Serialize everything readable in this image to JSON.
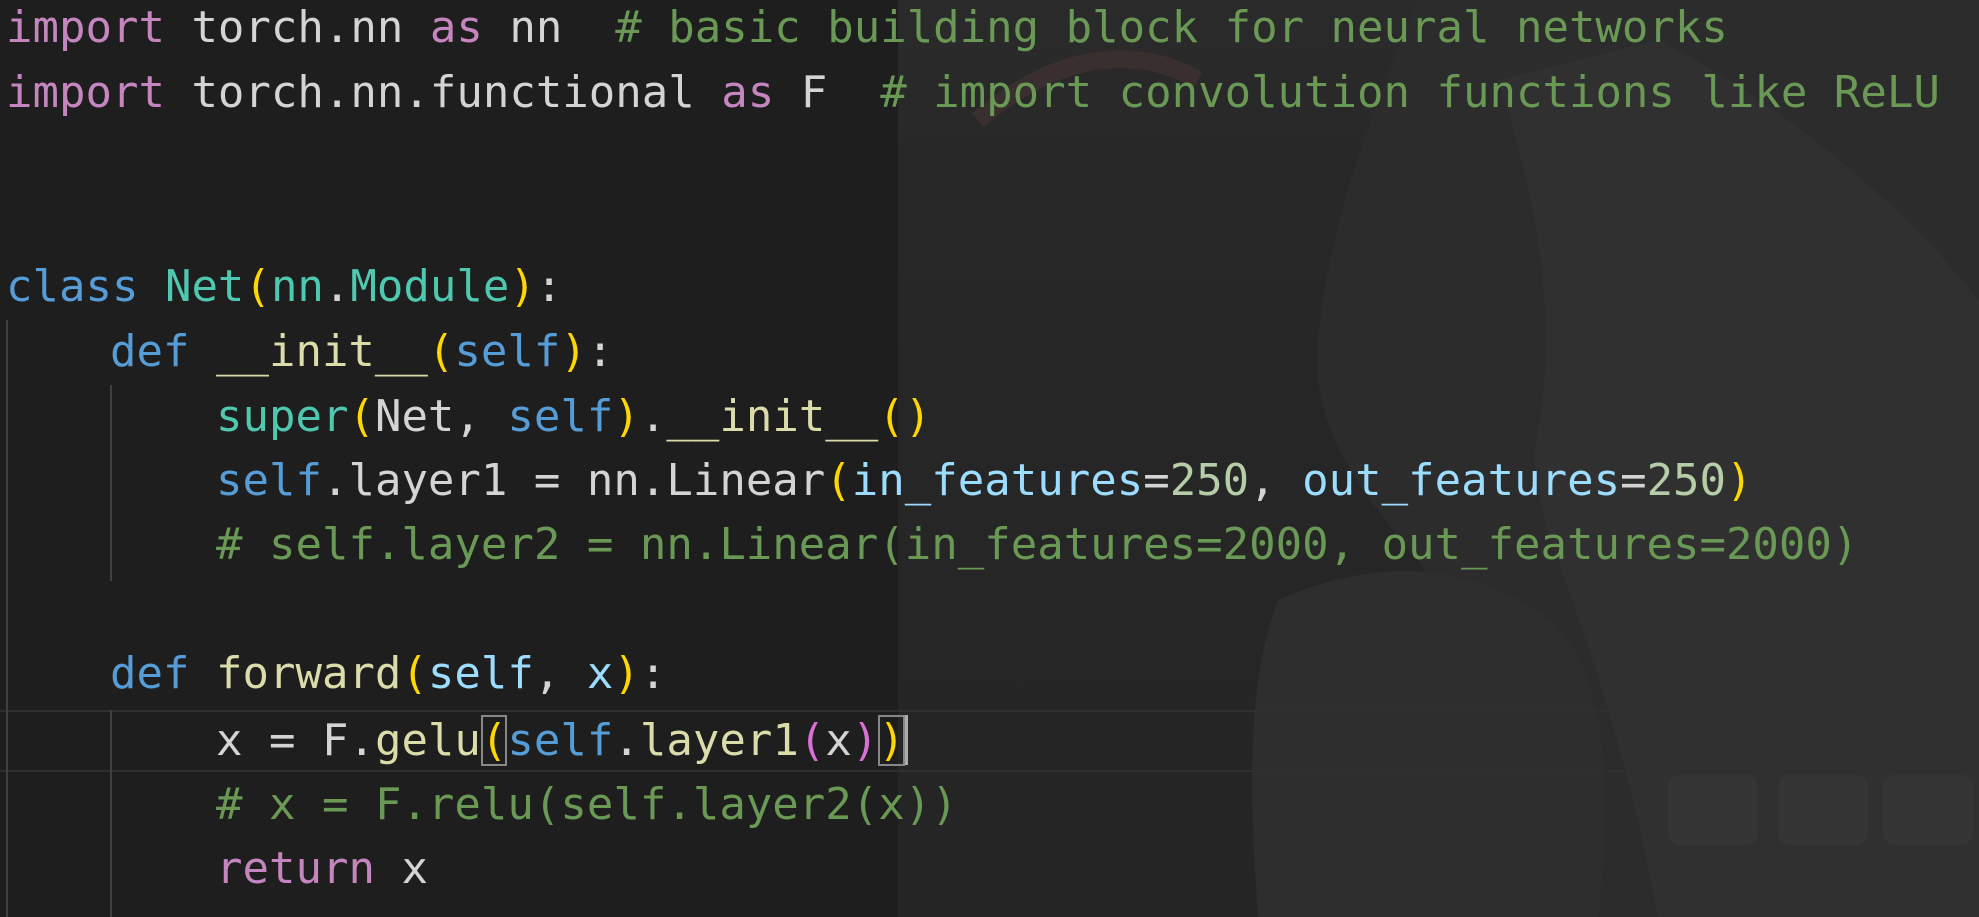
{
  "editor": {
    "lines": {
      "l1": {
        "import_kw": "import",
        "module": " torch.nn ",
        "as_kw": "as",
        "alias": " nn  ",
        "comment": "# basic building block for neural networks"
      },
      "l2": {
        "import_kw": "import",
        "module": " torch.nn.functional ",
        "as_kw": "as",
        "alias": " F  ",
        "comment": "# import convolution functions like ReLU"
      },
      "l5": {
        "class_kw": "class",
        "class_name": "Net",
        "open": "(",
        "base_mod": "nn",
        "dot": ".",
        "base_cls": "Module",
        "close": ")",
        "colon": ":"
      },
      "l6": {
        "def_kw": "def",
        "fn_name": "__init__",
        "open": "(",
        "self": "self",
        "close": ")",
        "colon": ":"
      },
      "l7": {
        "super": "super",
        "open": "(",
        "net": "Net, ",
        "self": "self",
        "close": ")",
        "dot": ".",
        "init": "__init__",
        "call": "()"
      },
      "l8": {
        "self": "self",
        "rest": ".layer1 = nn.Linear",
        "open": "(",
        "p1": "in_features",
        "eq1": "=",
        "v1": "250",
        "sep": ", ",
        "p2": "out_features",
        "eq2": "=",
        "v2": "250",
        "close": ")"
      },
      "l9": {
        "comment": "# self.layer2 = nn.Linear(in_features=2000, out_features=2000)"
      },
      "l11": {
        "def_kw": "def",
        "fn_name": "forward",
        "open": "(",
        "self": "self",
        "sep": ", ",
        "x": "x",
        "close": ")",
        "colon": ":"
      },
      "l12": {
        "lhs": "x = F.",
        "fn": "gelu",
        "open1": "(",
        "self": "self",
        "dot": ".",
        "layer": "layer1",
        "open2": "(",
        "x": "x",
        "close2": ")",
        "close1": ")"
      },
      "l13": {
        "comment": "# x = F.relu(self.layer2(x))"
      },
      "l14": {
        "return_kw": "return",
        "val": " x"
      }
    }
  },
  "colors": {
    "background": "#1e1e1e",
    "keyword_import": "#c586c0",
    "keyword": "#569cd6",
    "class": "#4ec9b0",
    "function": "#dcdcaa",
    "parameter": "#9cdcfe",
    "number": "#b5cea8",
    "comment": "#6a9955",
    "bracket_level1": "#ffd700",
    "bracket_level2": "#da70d6"
  }
}
